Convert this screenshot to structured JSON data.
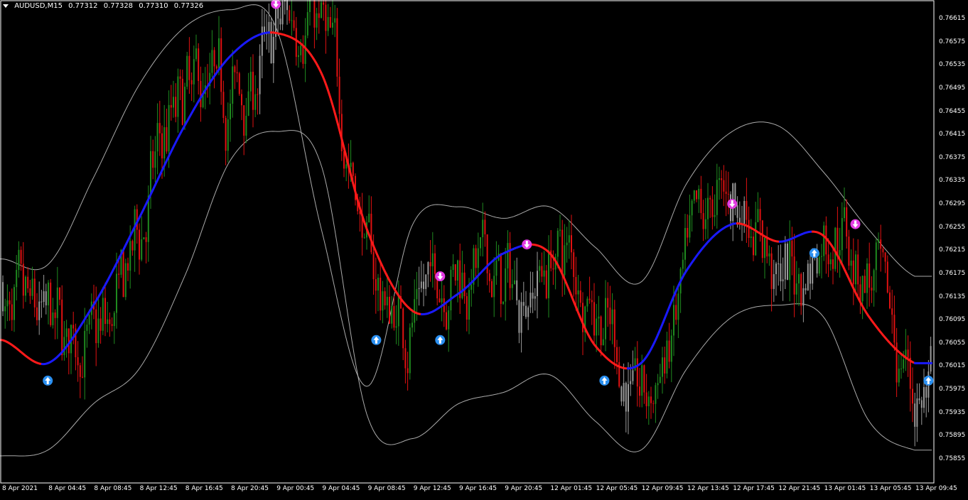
{
  "header": {
    "symbol": "AUDUSD,M15",
    "open": "0.77312",
    "high": "0.77328",
    "low": "0.77310",
    "close": "0.77326"
  },
  "colors": {
    "background": "#000000",
    "bull_candle": "#1f8a1f",
    "bear_candle": "#e11111",
    "neutral_candle": "#9a9a9a",
    "ma_up": "#1a1aff",
    "ma_down": "#ff1a1a",
    "envelope": "#c8c8c8",
    "buy_arrow": "#2a8ff0",
    "sell_arrow": "#e23be2",
    "axis": "#ffffff"
  },
  "price_axis": [
    "0.76615",
    "0.76575",
    "0.76535",
    "0.76495",
    "0.76455",
    "0.76415",
    "0.76375",
    "0.76335",
    "0.76295",
    "0.76255",
    "0.76215",
    "0.76175",
    "0.76135",
    "0.76095",
    "0.76055",
    "0.76015",
    "0.75975",
    "0.75935",
    "0.75895",
    "0.75855"
  ],
  "time_axis": [
    "8 Apr 2021",
    "8 Apr 04:45",
    "8 Apr 08:45",
    "8 Apr 12:45",
    "8 Apr 16:45",
    "8 Apr 20:45",
    "9 Apr 00:45",
    "9 Apr 04:45",
    "9 Apr 08:45",
    "9 Apr 12:45",
    "9 Apr 16:45",
    "9 Apr 20:45",
    "12 Apr 01:45",
    "12 Apr 05:45",
    "12 Apr 09:45",
    "12 Apr 13:45",
    "12 Apr 17:45",
    "12 Apr 21:45",
    "13 Apr 01:45",
    "13 Apr 05:45",
    "13 Apr 09:45"
  ],
  "chart_data": {
    "type": "line",
    "instrument": "AUDUSD",
    "timeframe": "M15",
    "ylim": [
      0.75855,
      0.76635
    ],
    "x": [
      "8 Apr 2021",
      "8 Apr 04:45",
      "8 Apr 08:45",
      "8 Apr 12:45",
      "8 Apr 16:45",
      "8 Apr 20:45",
      "9 Apr 00:45",
      "9 Apr 04:45",
      "9 Apr 08:45",
      "9 Apr 12:45",
      "9 Apr 16:45",
      "9 Apr 20:45",
      "12 Apr 01:45",
      "12 Apr 05:45",
      "12 Apr 09:45",
      "12 Apr 13:45",
      "12 Apr 17:45",
      "12 Apr 21:45",
      "13 Apr 01:45",
      "13 Apr 05:45",
      "13 Apr 09:45"
    ],
    "series": [
      {
        "values": [
          0.7606,
          0.7602,
          0.7612,
          0.7627,
          0.7643,
          0.7655,
          0.7659,
          0.7652,
          0.7625,
          0.7611,
          0.7614,
          0.7621,
          0.7621,
          0.7605,
          0.7602,
          0.7618,
          0.7626,
          0.7623,
          0.7624,
          0.761,
          0.7602
        ]
      },
      {
        "values": [
          0.762,
          0.7619,
          0.7634,
          0.765,
          0.766,
          0.7663,
          0.766,
          0.7625,
          0.7598,
          0.7626,
          0.7629,
          0.7627,
          0.7629,
          0.7622,
          0.7616,
          0.7633,
          0.7642,
          0.7643,
          0.7635,
          0.7625,
          0.7617
        ]
      },
      {
        "values": [
          0.7586,
          0.7587,
          0.7595,
          0.7601,
          0.7617,
          0.7637,
          0.7642,
          0.7636,
          0.7593,
          0.7589,
          0.7595,
          0.7597,
          0.76,
          0.7592,
          0.7587,
          0.7601,
          0.761,
          0.7612,
          0.761,
          0.7592,
          0.7587
        ]
      }
    ],
    "signals": [
      {
        "type": "buy",
        "x": "8 Apr 04:45",
        "y": 0.7599
      },
      {
        "type": "sell",
        "x": "9 Apr 00:45",
        "y": 0.7664
      },
      {
        "type": "sell",
        "x": "9 Apr 12:45",
        "y": 0.7617
      },
      {
        "type": "buy",
        "x": "9 Apr 08:45",
        "y": 0.7606
      },
      {
        "type": "buy",
        "x": "9 Apr 12:45",
        "y": 0.7606
      },
      {
        "type": "sell",
        "x": "9 Apr 20:45",
        "y": 0.76225
      },
      {
        "type": "buy",
        "x": "12 Apr 05:45",
        "y": 0.7599
      },
      {
        "type": "sell",
        "x": "12 Apr 17:45",
        "y": 0.76295
      },
      {
        "type": "buy",
        "x": "12 Apr 21:45",
        "y": 0.7621
      },
      {
        "type": "sell",
        "x": "13 Apr 01:45",
        "y": 0.7626
      },
      {
        "type": "buy",
        "x": "13 Apr 09:45",
        "y": 0.7599
      }
    ],
    "grid": false
  }
}
